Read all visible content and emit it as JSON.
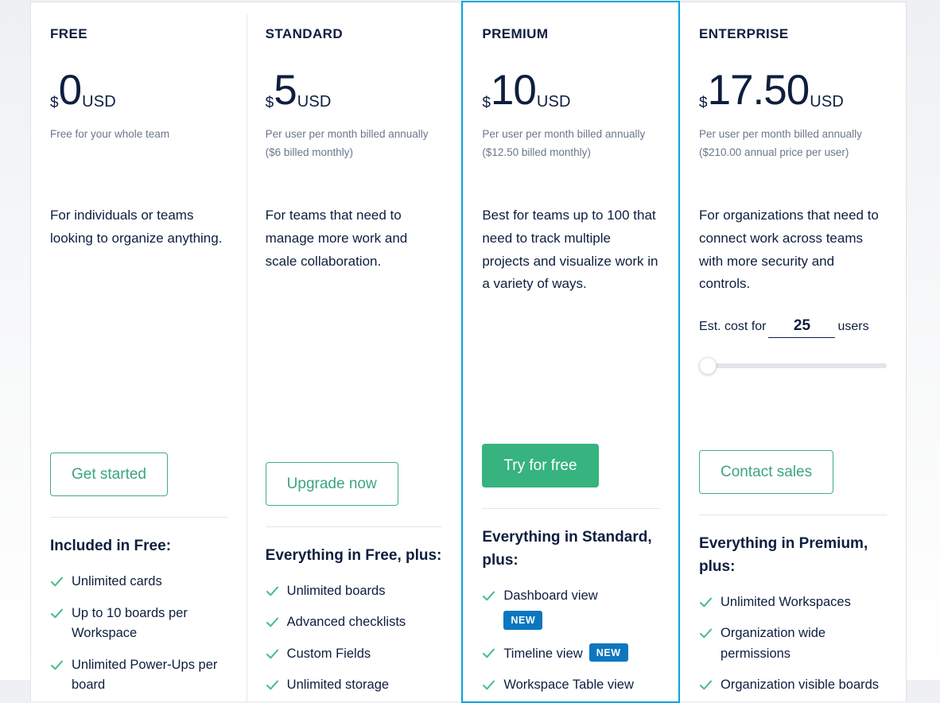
{
  "colors": {
    "highlight_border": "#0aa6d6",
    "primary_cta": "#36b37e",
    "outline_cta_text": "#3aa67c",
    "badge": "#0c77bf",
    "check": "#4bbf8a",
    "heading": "#0e1e3f",
    "muted": "#6b778c"
  },
  "plans": [
    {
      "name": "FREE",
      "currency": "$",
      "amount": "0",
      "unit": "USD",
      "price_note": "Free for your whole team",
      "description": "For individuals or teams looking to organize anything.",
      "cta": {
        "label": "Get started",
        "style": "outline"
      },
      "features_heading": "Included in Free:",
      "features": [
        {
          "text": "Unlimited cards"
        },
        {
          "text": "Up to 10 boards per Workspace"
        },
        {
          "text": "Unlimited Power-Ups per board"
        }
      ],
      "highlighted": false
    },
    {
      "name": "STANDARD",
      "currency": "$",
      "amount": "5",
      "unit": "USD",
      "price_note": "Per user per month billed annually ($6 billed monthly)",
      "description": "For teams that need to manage more work and scale collaboration.",
      "cta": {
        "label": "Upgrade now",
        "style": "outline"
      },
      "features_heading": "Everything in Free, plus:",
      "features": [
        {
          "text": "Unlimited boards"
        },
        {
          "text": "Advanced checklists"
        },
        {
          "text": "Custom Fields"
        },
        {
          "text": "Unlimited storage"
        }
      ],
      "highlighted": false
    },
    {
      "name": "PREMIUM",
      "currency": "$",
      "amount": "10",
      "unit": "USD",
      "price_note": "Per user per month billed annually ($12.50 billed monthly)",
      "description": "Best for teams up to 100 that need to track multiple projects and visualize work in a variety of ways.",
      "cta": {
        "label": "Try for free",
        "style": "primary"
      },
      "features_heading": "Everything in Standard, plus:",
      "features": [
        {
          "text": "Dashboard view",
          "badge": "NEW",
          "badge_position": "block"
        },
        {
          "text": "Timeline view",
          "badge": "NEW",
          "badge_position": "inline"
        },
        {
          "text": "Workspace Table view"
        }
      ],
      "highlighted": true
    },
    {
      "name": "ENTERPRISE",
      "currency": "$",
      "amount": "17.50",
      "unit": "USD",
      "price_note": "Per user per month billed annually ($210.00 annual price per user)",
      "description": "For organizations that need to connect work across teams with more security and controls.",
      "estimator": {
        "label_before": "Est. cost for",
        "label_after": "users",
        "value": "25",
        "slider_percent": 0
      },
      "cta": {
        "label": "Contact sales",
        "style": "outline"
      },
      "features_heading": "Everything in Premium, plus:",
      "features": [
        {
          "text": "Unlimited Workspaces"
        },
        {
          "text": "Organization wide permissions"
        },
        {
          "text": "Organization visible boards"
        }
      ],
      "highlighted": false
    }
  ]
}
